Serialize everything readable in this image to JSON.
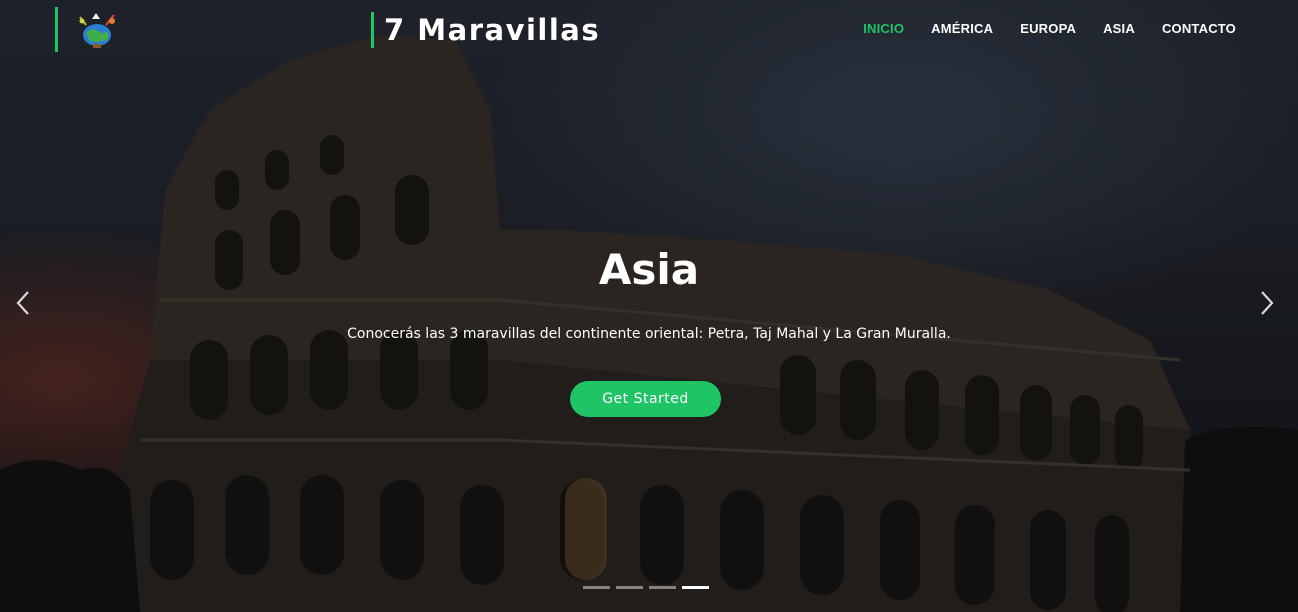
{
  "brand": {
    "logo_icon": "globe-logo-icon",
    "name": "7 Maravillas"
  },
  "nav": {
    "items": [
      {
        "label": "INICIO",
        "active": true
      },
      {
        "label": "AMÉRICA",
        "active": false
      },
      {
        "label": "EUROPA",
        "active": false
      },
      {
        "label": "ASIA",
        "active": false
      },
      {
        "label": "CONTACTO",
        "active": false
      }
    ]
  },
  "hero": {
    "title": "Asia",
    "description": "Conocerás las 3 maravillas del continente oriental: Petra, Taj Mahal y La Gran Muralla.",
    "cta_label": "Get Started",
    "prev_icon": "chevron-left-icon",
    "next_icon": "chevron-right-icon",
    "slide_count": 4,
    "active_slide": 4
  },
  "colors": {
    "accent": "#1ec466",
    "text": "#ffffff"
  }
}
